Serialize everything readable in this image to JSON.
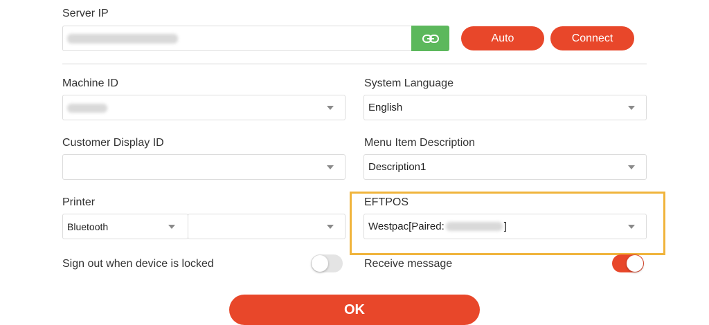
{
  "server": {
    "label": "Server IP",
    "auto_button": "Auto",
    "connect_button": "Connect"
  },
  "machine_id": {
    "label": "Machine ID"
  },
  "system_language": {
    "label": "System Language",
    "value": "English"
  },
  "customer_display_id": {
    "label": "Customer Display ID",
    "value": ""
  },
  "menu_item_description": {
    "label": "Menu Item Description",
    "value": "Description1"
  },
  "printer": {
    "label": "Printer",
    "type_value": "Bluetooth",
    "device_value": ""
  },
  "eftpos": {
    "label": "EFTPOS",
    "value_prefix": "Westpac[Paired:",
    "value_suffix": "]"
  },
  "sign_out": {
    "label": "Sign out when device is locked",
    "enabled": false
  },
  "receive_message": {
    "label": "Receive message",
    "enabled": true
  },
  "ok_button": "OK",
  "colors": {
    "accent": "#e8472a",
    "link_button": "#5cb85c",
    "highlight_border": "#f0b43c",
    "toggle_off": "#e4e4e4"
  }
}
